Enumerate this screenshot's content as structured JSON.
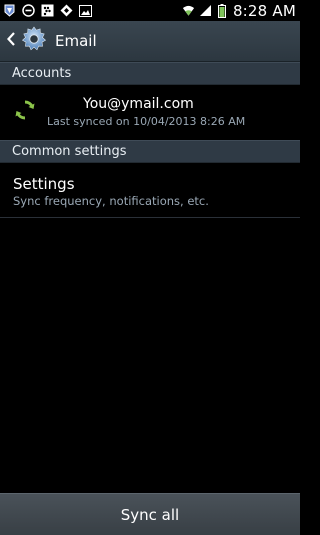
{
  "status_bar": {
    "time": "8:28 AM",
    "left_icons": [
      "app-notification-icon",
      "do-not-disturb-icon",
      "bbm-icon",
      "dropbox-icon",
      "image-icon"
    ],
    "right_icons": [
      "wifi-icon",
      "signal-icon",
      "battery-icon"
    ]
  },
  "action_bar": {
    "title": "Email"
  },
  "sections": {
    "accounts_header": "Accounts",
    "common_header": "Common settings"
  },
  "account": {
    "name_visible": "You",
    "address": "@ymail.com",
    "last_synced": "Last synced on 10/04/2013 8:26 AM",
    "sync_icon_color": "#8bc34a"
  },
  "settings": {
    "title": "Settings",
    "subtitle": "Sync frequency, notifications, etc."
  },
  "footer": {
    "sync_all_label": "Sync all"
  },
  "colors": {
    "action_bar": "#34404a",
    "section_header": "#2f3a45",
    "background": "#000000",
    "secondary_text": "#9aa8b5"
  }
}
